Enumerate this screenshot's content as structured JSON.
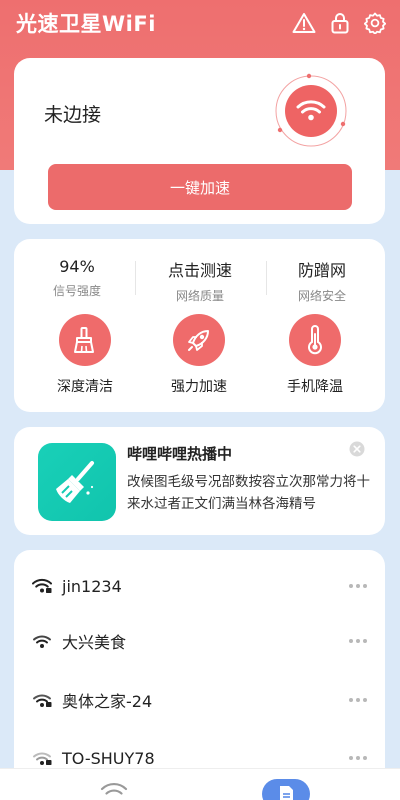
{
  "app": {
    "title": "光速卫星WiFi"
  },
  "header": {
    "icons": [
      "warning-icon",
      "lock-icon",
      "gear-icon"
    ]
  },
  "status": {
    "text": "未边接",
    "button_label": "一键加速"
  },
  "stats": [
    {
      "value": "94%",
      "label": "信号强度"
    },
    {
      "value": "点击测速",
      "label": "网络质量"
    },
    {
      "value": "防蹭网",
      "label": "网络安全"
    }
  ],
  "tools": [
    {
      "label": "深度清洁",
      "icon": "broom-icon"
    },
    {
      "label": "强力加速",
      "icon": "rocket-icon"
    },
    {
      "label": "手机降温",
      "icon": "thermometer-icon"
    }
  ],
  "ad": {
    "title": "哔哩哔哩热播中",
    "description": "改候图毛级号况部数按容立次那常力将十来水过者正文们满当林各海精号",
    "icon": "broom-icon"
  },
  "wifi_list": [
    {
      "name": "jin1234"
    },
    {
      "name": "大兴美食"
    },
    {
      "name": "奥体之家-24"
    },
    {
      "name": "TO-SHUY78"
    }
  ],
  "colors": {
    "brand": "#ee6f6f",
    "button": "#ec6b6b",
    "ad_icon": "#15cbb3",
    "nav_active": "#5b8ce8",
    "background": "#dbe9f8"
  }
}
